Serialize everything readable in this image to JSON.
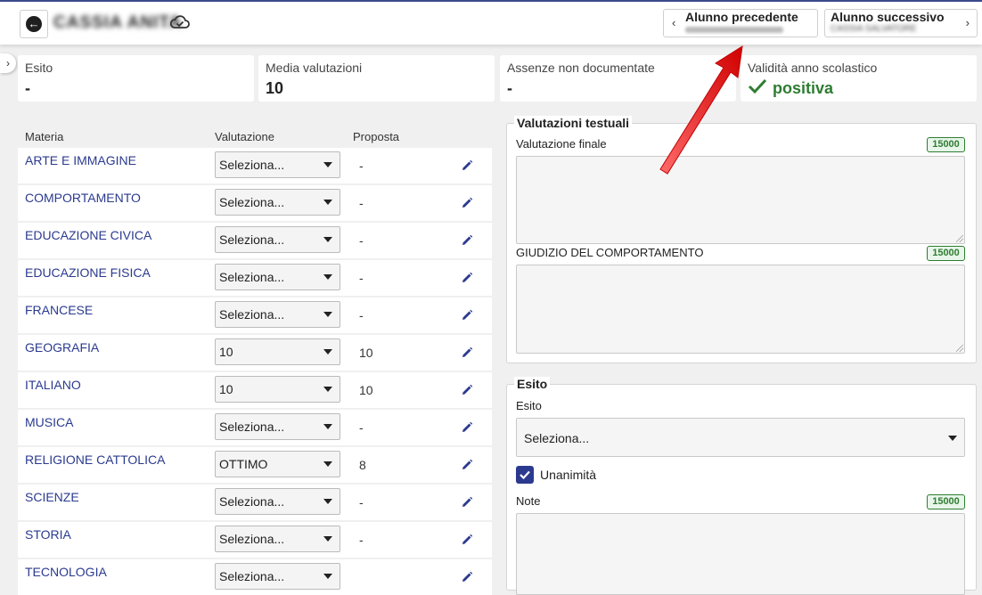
{
  "header": {
    "student_name": "CASSIA ANITA",
    "prev_label": "Alunno precedente",
    "prev_name": "",
    "next_label": "Alunno successivo",
    "next_name": "CASSIA SALVATORE"
  },
  "summary": {
    "esito_label": "Esito",
    "esito_value": "-",
    "media_label": "Media valutazioni",
    "media_value": "10",
    "assenze_label": "Assenze non documentate",
    "assenze_value": "-",
    "validita_label": "Validità anno scolastico",
    "validita_value": "positiva"
  },
  "table": {
    "columns": [
      "Materia",
      "Valutazione",
      "Proposta"
    ],
    "rows": [
      {
        "subject": "ARTE E IMMAGINE",
        "grade": "Seleziona...",
        "proposal": "-"
      },
      {
        "subject": "COMPORTAMENTO",
        "grade": "Seleziona...",
        "proposal": "-"
      },
      {
        "subject": "EDUCAZIONE CIVICA",
        "grade": "Seleziona...",
        "proposal": "-"
      },
      {
        "subject": "EDUCAZIONE FISICA",
        "grade": "Seleziona...",
        "proposal": "-"
      },
      {
        "subject": "FRANCESE",
        "grade": "Seleziona...",
        "proposal": "-"
      },
      {
        "subject": "GEOGRAFIA",
        "grade": "10",
        "proposal": "10"
      },
      {
        "subject": "ITALIANO",
        "grade": "10",
        "proposal": "10"
      },
      {
        "subject": "MUSICA",
        "grade": "Seleziona...",
        "proposal": "-"
      },
      {
        "subject": "RELIGIONE CATTOLICA",
        "grade": "OTTIMO",
        "proposal": "8"
      },
      {
        "subject": "SCIENZE",
        "grade": "Seleziona...",
        "proposal": "-"
      },
      {
        "subject": "STORIA",
        "grade": "Seleziona...",
        "proposal": "-"
      },
      {
        "subject": "TECNOLOGIA",
        "grade": "Seleziona...",
        "proposal": ""
      }
    ]
  },
  "valutazioni_testuali": {
    "legend": "Valutazioni testuali",
    "finale_label": "Valutazione finale",
    "finale_limit": "15000",
    "comportamento_label": "GIUDIZIO DEL COMPORTAMENTO",
    "comportamento_limit": "15000"
  },
  "esito_section": {
    "legend": "Esito",
    "esito_label": "Esito",
    "esito_select": "Seleziona...",
    "unanimita_label": "Unanimità",
    "note_label": "Note",
    "note_limit": "15000"
  },
  "colors": {
    "accent": "#2b3a8f",
    "positive": "#2e7d32",
    "annotation_arrow": "#e00000"
  }
}
